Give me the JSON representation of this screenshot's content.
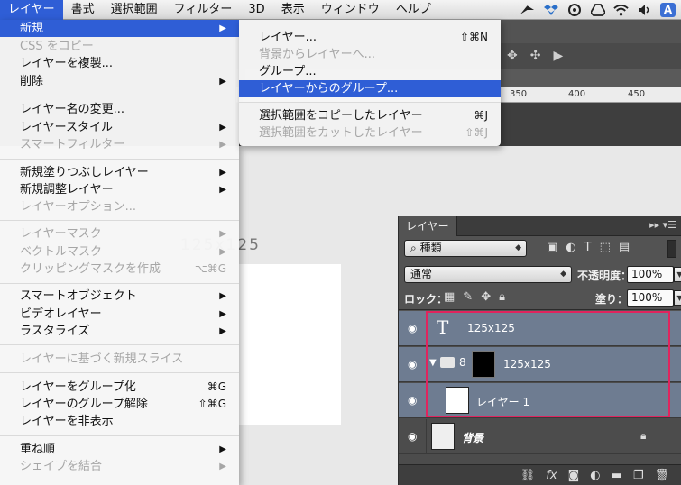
{
  "menubar": {
    "items": [
      "レイヤー",
      "書式",
      "選択範囲",
      "フィルター",
      "3D",
      "表示",
      "ウィンドウ",
      "ヘルプ"
    ],
    "active_index": 0,
    "tray": [
      "feather-icon",
      "dropbox-icon",
      "creative-cloud-icon",
      "google-drive-icon",
      "wifi-icon",
      "volume-icon",
      "adobe-a-icon"
    ]
  },
  "menu": {
    "items": [
      {
        "label": "新規",
        "arrow": true,
        "highlighted": true
      },
      {
        "label": "CSS をコピー",
        "disabled": true
      },
      {
        "label": "レイヤーを複製..."
      },
      {
        "label": "削除",
        "arrow": true
      },
      {
        "label": "レイヤー名の変更..."
      },
      {
        "label": "レイヤースタイル",
        "arrow": true
      },
      {
        "label": "スマートフィルター",
        "arrow": true,
        "disabled": true
      },
      {
        "label": "新規塗りつぶしレイヤー",
        "arrow": true
      },
      {
        "label": "新規調整レイヤー",
        "arrow": true
      },
      {
        "label": "レイヤーオプション...",
        "disabled": true
      },
      {
        "label": "レイヤーマスク",
        "arrow": true,
        "disabled": true
      },
      {
        "label": "ベクトルマスク",
        "arrow": true,
        "disabled": true
      },
      {
        "label": "クリッピングマスクを作成",
        "shortcut": "⌥⌘G",
        "disabled": true
      },
      {
        "label": "スマートオブジェクト",
        "arrow": true
      },
      {
        "label": "ビデオレイヤー",
        "arrow": true
      },
      {
        "label": "ラスタライズ",
        "arrow": true
      },
      {
        "label": "レイヤーに基づく新規スライス",
        "disabled": true
      },
      {
        "label": "レイヤーをグループ化",
        "shortcut": "⌘G"
      },
      {
        "label": "レイヤーのグループ解除",
        "shortcut": "⇧⌘G"
      },
      {
        "label": "レイヤーを非表示"
      },
      {
        "label": "重ね順",
        "arrow": true
      },
      {
        "label": "シェイプを結合",
        "arrow": true,
        "disabled": true
      }
    ]
  },
  "submenu": {
    "items": [
      {
        "label": "レイヤー...",
        "shortcut": "⇧⌘N"
      },
      {
        "label": "背景からレイヤーへ...",
        "disabled": true
      },
      {
        "label": "グループ..."
      },
      {
        "label": "レイヤーからのグループ...",
        "highlighted": true
      },
      {
        "label": "選択範囲をコピーしたレイヤー",
        "shortcut": "⌘J"
      },
      {
        "label": "選択範囲をカットしたレイヤー",
        "shortcut": "⇧⌘J",
        "disabled": true
      }
    ]
  },
  "workspace": {
    "ruler_ticks": [
      "350",
      "400",
      "450"
    ],
    "canvas_text": "125x125"
  },
  "layers_panel": {
    "tab": "レイヤー",
    "filter_value": "種類",
    "blend_mode": "通常",
    "opacity_label": "不透明度：",
    "opacity_value": "100%",
    "lock_label": "ロック：",
    "fill_label": "塗り：",
    "fill_value": "100%",
    "layers": [
      {
        "name": "125x125",
        "kind": "text",
        "selected": true
      },
      {
        "name": "125x125",
        "kind": "group",
        "selected": true
      },
      {
        "name": "レイヤー 1",
        "kind": "pixel",
        "selected": true
      },
      {
        "name": "背景",
        "kind": "background",
        "selected": false,
        "locked": true
      }
    ]
  },
  "colors": {
    "highlight": "#2f5ed6",
    "selection_border": "#e0245e",
    "selected_layer": "#6e7c91"
  }
}
